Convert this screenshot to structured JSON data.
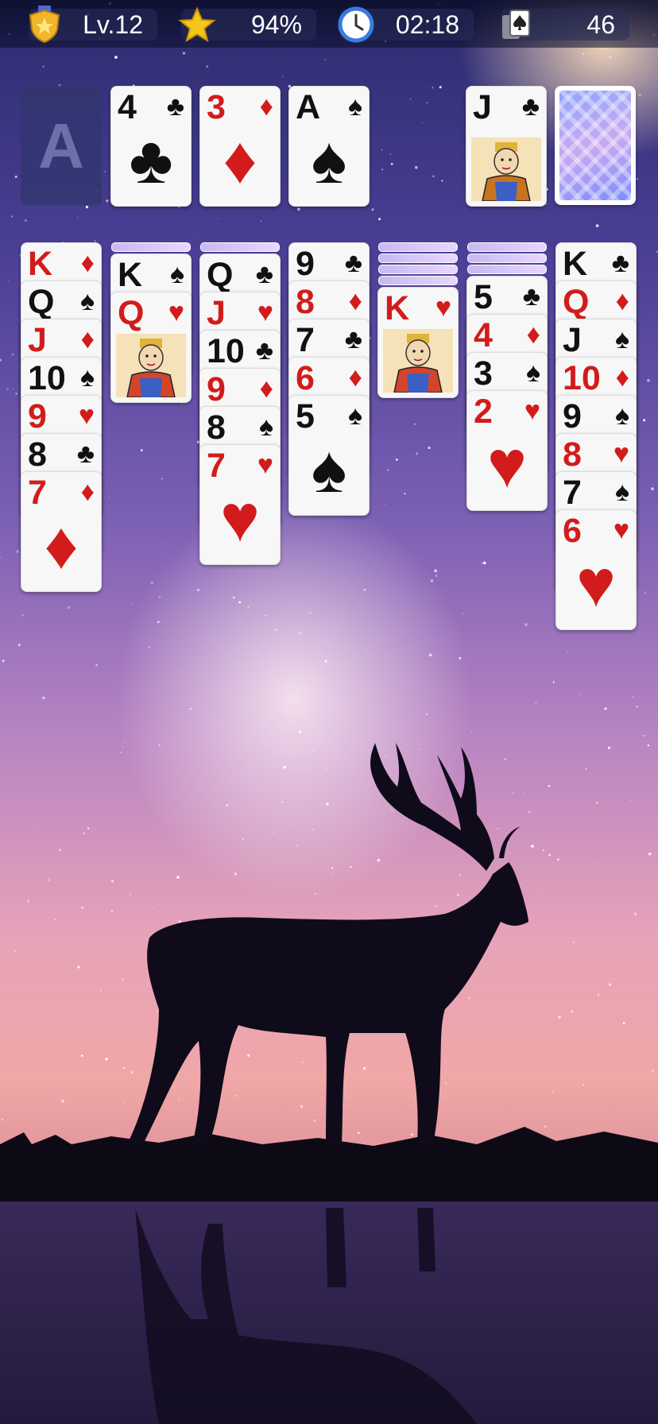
{
  "status_bar": {
    "level": "Lv.12",
    "rating": "94%",
    "timer": "02:18",
    "cards_left": "46"
  },
  "foundations": [
    {
      "rank": "A",
      "suit": "♠",
      "empty": true
    },
    {
      "rank": "4",
      "suit": "♣",
      "color": "black"
    },
    {
      "rank": "3",
      "suit": "♦",
      "color": "red"
    },
    {
      "rank": "A",
      "suit": "♠",
      "color": "black"
    }
  ],
  "waste": {
    "rank": "J",
    "suit": "♣",
    "color": "black"
  },
  "tableau": [
    {
      "hidden": 0,
      "cards": [
        [
          "K",
          "♦",
          "red"
        ],
        [
          "Q",
          "♠",
          "black"
        ],
        [
          "J",
          "♦",
          "red"
        ],
        [
          "10",
          "♠",
          "black"
        ],
        [
          "9",
          "♥",
          "red"
        ],
        [
          "8",
          "♣",
          "black"
        ],
        [
          "7",
          "♦",
          "red"
        ]
      ]
    },
    {
      "hidden": 1,
      "cards": [
        [
          "K",
          "♠",
          "black"
        ],
        [
          "Q",
          "♥",
          "red"
        ]
      ]
    },
    {
      "hidden": 1,
      "cards": [
        [
          "Q",
          "♣",
          "black"
        ],
        [
          "J",
          "♥",
          "red"
        ],
        [
          "10",
          "♣",
          "black"
        ],
        [
          "9",
          "♦",
          "red"
        ],
        [
          "8",
          "♠",
          "black"
        ],
        [
          "7",
          "♥",
          "red"
        ]
      ]
    },
    {
      "hidden": 0,
      "cards": [
        [
          "9",
          "♣",
          "black"
        ],
        [
          "8",
          "♦",
          "red"
        ],
        [
          "7",
          "♣",
          "black"
        ],
        [
          "6",
          "♦",
          "red"
        ],
        [
          "5",
          "♠",
          "black"
        ]
      ]
    },
    {
      "hidden": 4,
      "cards": [
        [
          "K",
          "♥",
          "red"
        ]
      ]
    },
    {
      "hidden": 3,
      "cards": [
        [
          "5",
          "♣",
          "black"
        ],
        [
          "4",
          "♦",
          "red"
        ],
        [
          "3",
          "♠",
          "black"
        ],
        [
          "2",
          "♥",
          "red"
        ]
      ]
    },
    {
      "hidden": 0,
      "cards": [
        [
          "K",
          "♣",
          "black"
        ],
        [
          "Q",
          "♦",
          "red"
        ],
        [
          "J",
          "♠",
          "black"
        ],
        [
          "10",
          "♦",
          "red"
        ],
        [
          "9",
          "♠",
          "black"
        ],
        [
          "8",
          "♥",
          "red"
        ],
        [
          "7",
          "♠",
          "black"
        ],
        [
          "6",
          "♥",
          "red"
        ]
      ]
    }
  ]
}
